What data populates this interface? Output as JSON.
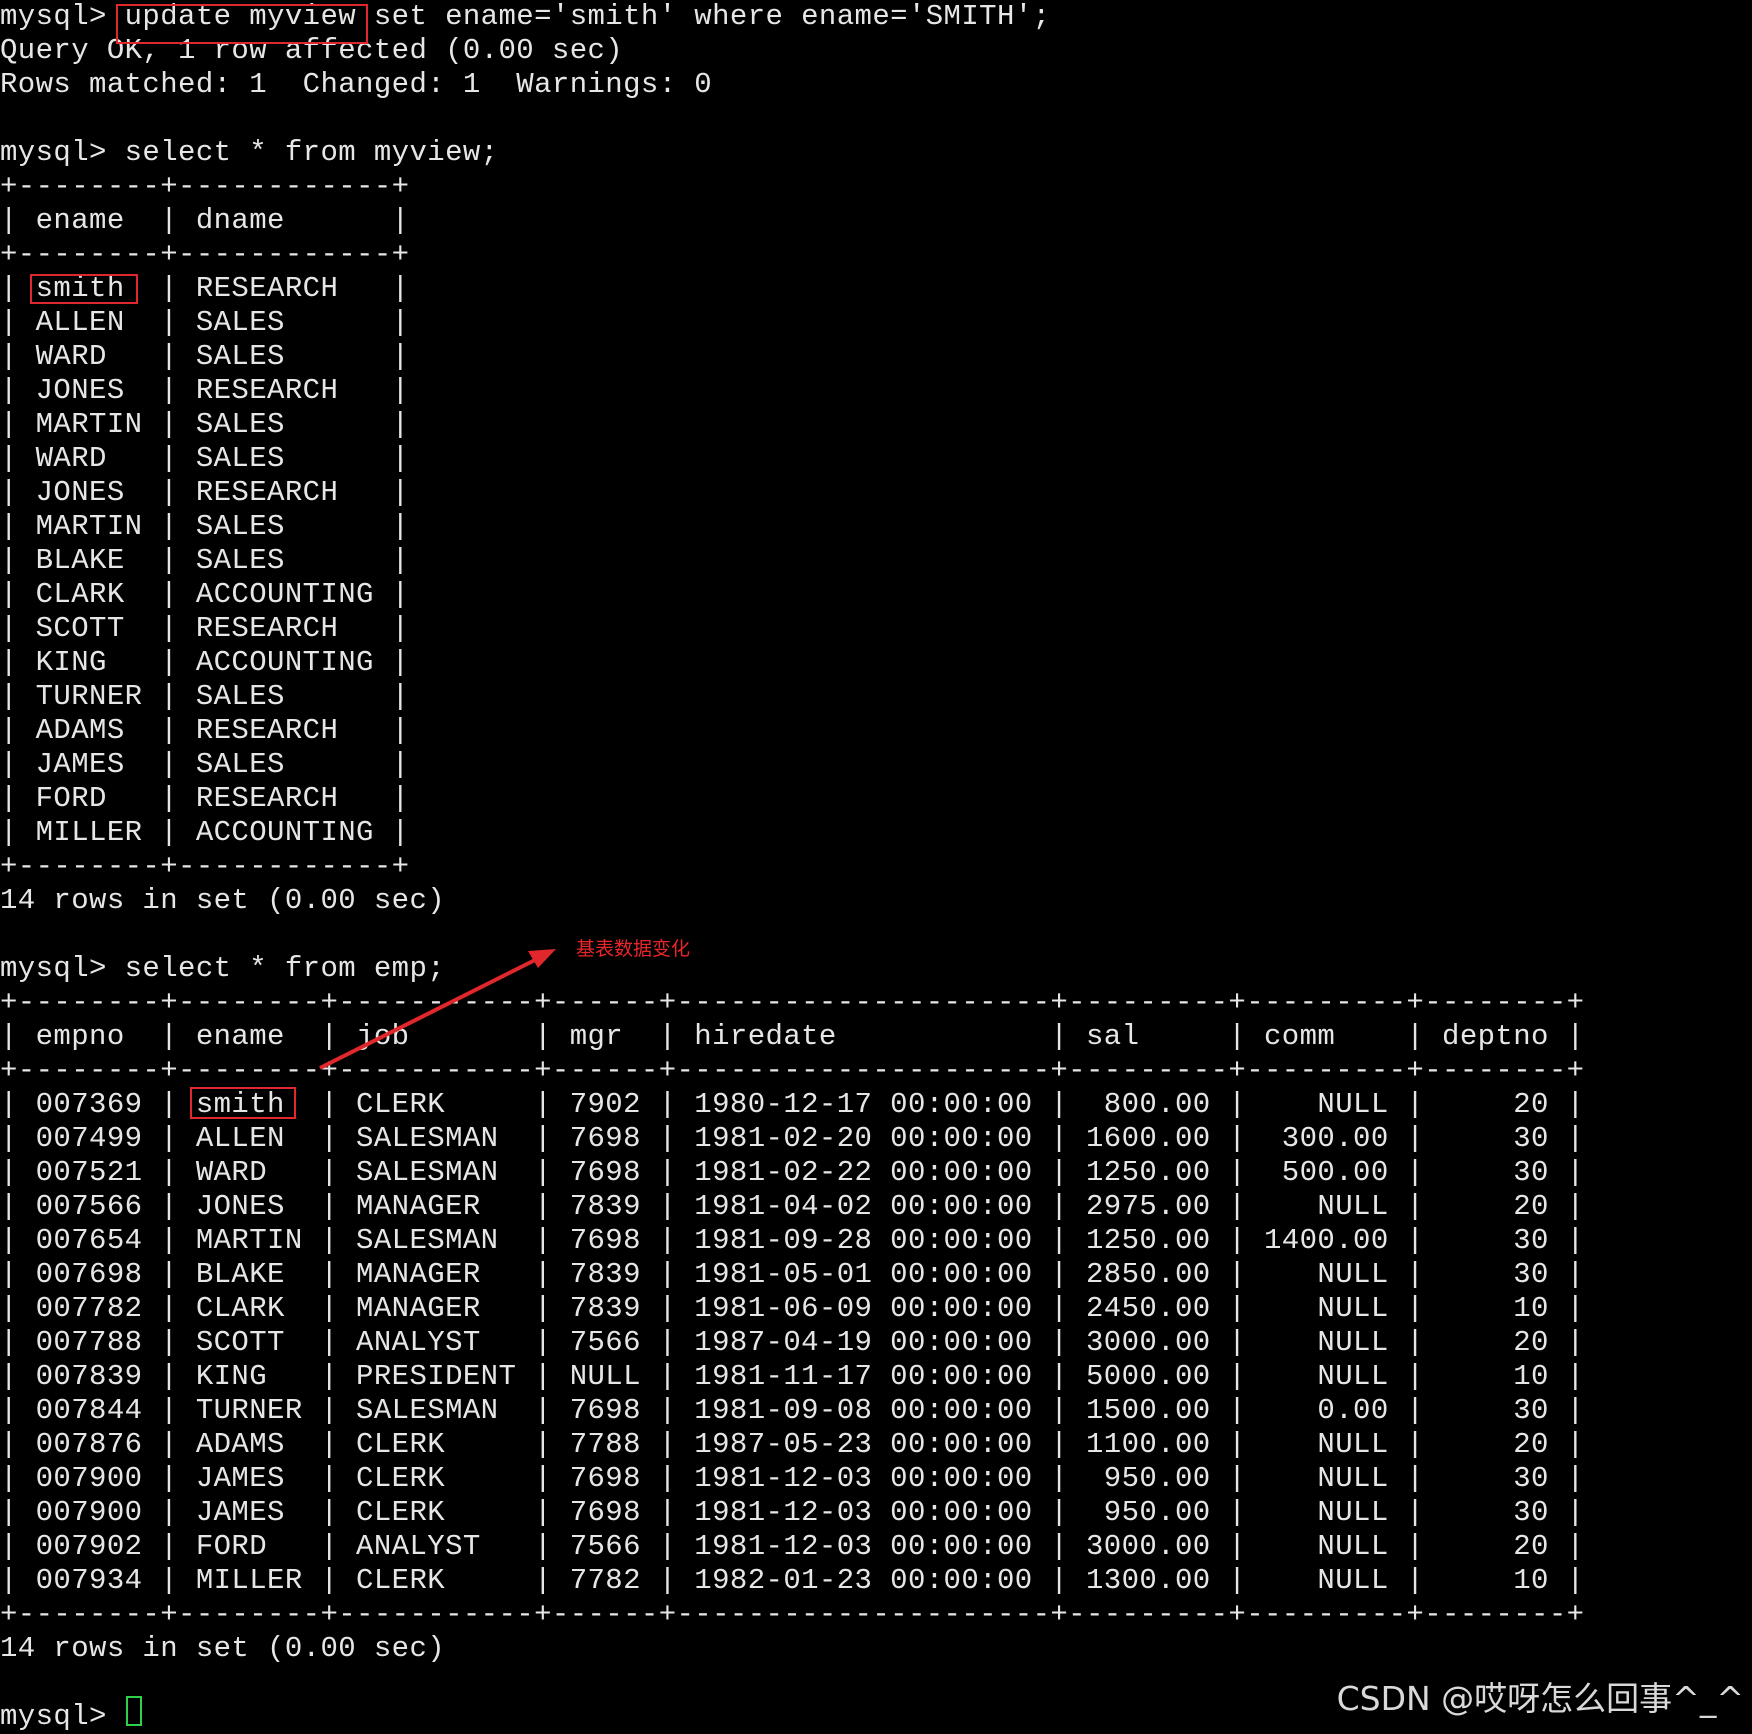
{
  "terminal": {
    "lines": [
      "mysql> update myview set ename='smith' where ename='SMITH';",
      "Query OK, 1 row affected (0.00 sec)",
      "Rows matched: 1  Changed: 1  Warnings: 0",
      "",
      "mysql> select * from myview;",
      "+--------+------------+",
      "| ename  | dname      |",
      "+--------+------------+",
      "| smith  | RESEARCH   |",
      "| ALLEN  | SALES      |",
      "| WARD   | SALES      |",
      "| JONES  | RESEARCH   |",
      "| MARTIN | SALES      |",
      "| WARD   | SALES      |",
      "| JONES  | RESEARCH   |",
      "| MARTIN | SALES      |",
      "| BLAKE  | SALES      |",
      "| CLARK  | ACCOUNTING |",
      "| SCOTT  | RESEARCH   |",
      "| KING   | ACCOUNTING |",
      "| TURNER | SALES      |",
      "| ADAMS  | RESEARCH   |",
      "| JAMES  | SALES      |",
      "| FORD   | RESEARCH   |",
      "| MILLER | ACCOUNTING |",
      "+--------+------------+",
      "14 rows in set (0.00 sec)",
      "",
      "mysql> select * from emp;",
      "+--------+--------+-----------+------+---------------------+---------+---------+--------+",
      "| empno  | ename  | job       | mgr  | hiredate            | sal     | comm    | deptno |",
      "+--------+--------+-----------+------+---------------------+---------+---------+--------+",
      "| 007369 | smith  | CLERK     | 7902 | 1980-12-17 00:00:00 |  800.00 |    NULL |     20 |",
      "| 007499 | ALLEN  | SALESMAN  | 7698 | 1981-02-20 00:00:00 | 1600.00 |  300.00 |     30 |",
      "| 007521 | WARD   | SALESMAN  | 7698 | 1981-02-22 00:00:00 | 1250.00 |  500.00 |     30 |",
      "| 007566 | JONES  | MANAGER   | 7839 | 1981-04-02 00:00:00 | 2975.00 |    NULL |     20 |",
      "| 007654 | MARTIN | SALESMAN  | 7698 | 1981-09-28 00:00:00 | 1250.00 | 1400.00 |     30 |",
      "| 007698 | BLAKE  | MANAGER   | 7839 | 1981-05-01 00:00:00 | 2850.00 |    NULL |     30 |",
      "| 007782 | CLARK  | MANAGER   | 7839 | 1981-06-09 00:00:00 | 2450.00 |    NULL |     10 |",
      "| 007788 | SCOTT  | ANALYST   | 7566 | 1987-04-19 00:00:00 | 3000.00 |    NULL |     20 |",
      "| 007839 | KING   | PRESIDENT | NULL | 1981-11-17 00:00:00 | 5000.00 |    NULL |     10 |",
      "| 007844 | TURNER | SALESMAN  | 7698 | 1981-09-08 00:00:00 | 1500.00 |    0.00 |     30 |",
      "| 007876 | ADAMS  | CLERK     | 7788 | 1987-05-23 00:00:00 | 1100.00 |    NULL |     20 |",
      "| 007900 | JAMES  | CLERK     | 7698 | 1981-12-03 00:00:00 |  950.00 |    NULL |     30 |",
      "| 007900 | JAMES  | CLERK     | 7698 | 1981-12-03 00:00:00 |  950.00 |    NULL |     30 |",
      "| 007902 | FORD   | ANALYST   | 7566 | 1981-12-03 00:00:00 | 3000.00 |    NULL |     20 |",
      "| 007934 | MILLER | CLERK     | 7782 | 1982-01-23 00:00:00 | 1300.00 |    NULL |     10 |",
      "+--------+--------+-----------+------+---------------------+---------+---------+--------+",
      "14 rows in set (0.00 sec)",
      "",
      "mysql> "
    ]
  },
  "annotation": {
    "label": "基表数据变化",
    "color": "#e0272b"
  },
  "watermark": "CSDN @哎呀怎么回事^_^",
  "colors": {
    "background": "#000000",
    "text": "#e6e6e6",
    "highlight": "#e0272b",
    "cursor": "#2fd04a"
  }
}
